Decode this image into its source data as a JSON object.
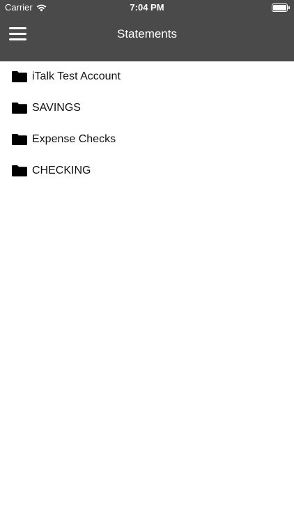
{
  "status_bar": {
    "carrier": "Carrier",
    "time": "7:04 PM",
    "wifi_icon": "wifi-icon",
    "battery_icon": "battery-full-icon"
  },
  "nav": {
    "title": "Statements",
    "menu_icon": "hamburger-menu-icon"
  },
  "colors": {
    "nav_background": "#4a4a4a",
    "nav_text": "#ffffff",
    "list_text": "#111111",
    "folder_icon": "#000000"
  },
  "folders": [
    {
      "label": "iTalk Test Account",
      "icon": "folder-icon"
    },
    {
      "label": "SAVINGS",
      "icon": "folder-icon"
    },
    {
      "label": "Expense Checks",
      "icon": "folder-icon"
    },
    {
      "label": "CHECKING",
      "icon": "folder-icon"
    }
  ]
}
